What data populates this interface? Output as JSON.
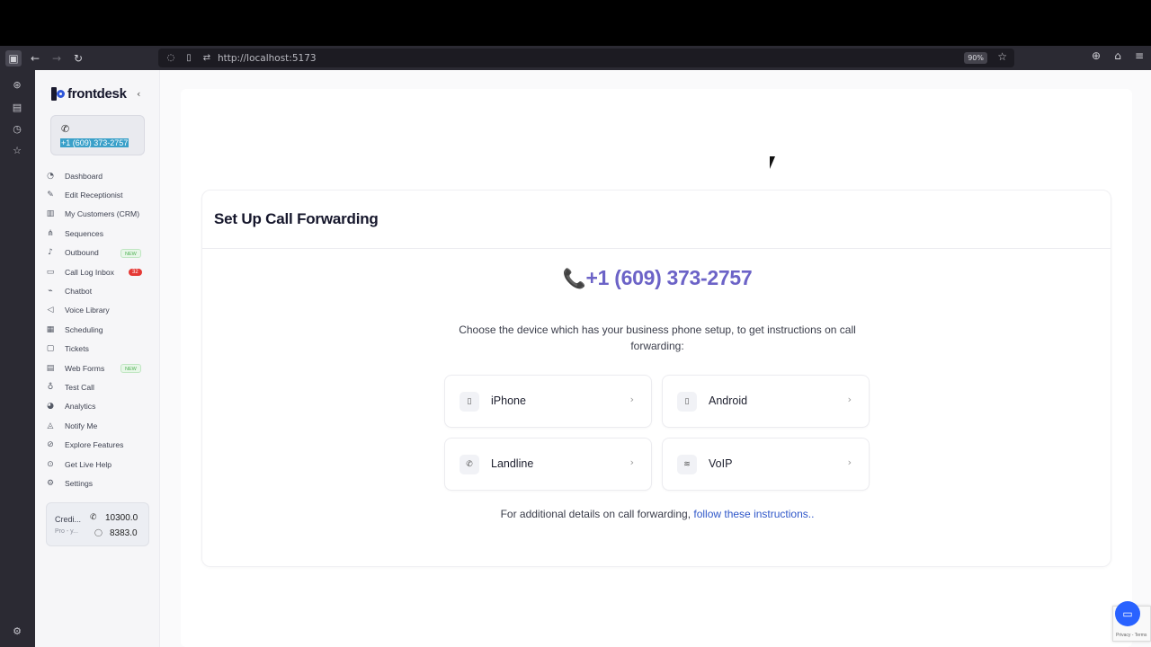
{
  "browser": {
    "url": "http://localhost:5173",
    "zoom": "90%"
  },
  "sidebar": {
    "logo_text": "frontdesk",
    "phone_number": "+1 (609) 373-2757",
    "items": [
      {
        "label": "Dashboard",
        "icon": "gauge-icon"
      },
      {
        "label": "Edit Receptionist",
        "icon": "pencil-icon"
      },
      {
        "label": "My Customers (CRM)",
        "icon": "bar-chart-icon"
      },
      {
        "label": "Sequences",
        "icon": "flow-icon"
      },
      {
        "label": "Outbound",
        "icon": "bell-icon",
        "badge": "NEW"
      },
      {
        "label": "Call Log Inbox",
        "icon": "inbox-icon",
        "count": "32"
      },
      {
        "label": "Chatbot",
        "icon": "chat-icon"
      },
      {
        "label": "Voice Library",
        "icon": "voice-icon"
      },
      {
        "label": "Scheduling",
        "icon": "calendar-icon"
      },
      {
        "label": "Tickets",
        "icon": "ticket-icon"
      },
      {
        "label": "Web Forms",
        "icon": "form-icon",
        "badge": "NEW"
      },
      {
        "label": "Test Call",
        "icon": "mic-icon"
      },
      {
        "label": "Analytics",
        "icon": "analytics-icon"
      },
      {
        "label": "Notify Me",
        "icon": "bell-icon"
      },
      {
        "label": "Explore Features",
        "icon": "compass-icon"
      },
      {
        "label": "Get Live Help",
        "icon": "help-icon"
      },
      {
        "label": "Settings",
        "icon": "gear-icon"
      }
    ],
    "credits": {
      "title": "Credi...",
      "subtitle": "Pro - y...",
      "call_credits": "10300.0",
      "chat_credits": "8383.0"
    }
  },
  "main": {
    "title": "Set Up Call Forwarding",
    "phone_display": "+1 (609) 373-2757",
    "description": "Choose the device which has your business phone setup, to get instructions on call forwarding:",
    "devices": [
      {
        "label": "iPhone",
        "icon": "smartphone-icon"
      },
      {
        "label": "Android",
        "icon": "smartphone-icon"
      },
      {
        "label": "Landline",
        "icon": "phone-icon"
      },
      {
        "label": "VoIP",
        "icon": "wifi-icon"
      }
    ],
    "footnote_text": "For additional details on call forwarding, ",
    "footnote_link": "follow these instructions.."
  },
  "recaptcha": {
    "text": "Privacy - Terms"
  },
  "colors": {
    "accent": "#6c63c7",
    "link": "#2f57c9",
    "badge_new": "#4caf50",
    "badge_count": "#e53935"
  }
}
